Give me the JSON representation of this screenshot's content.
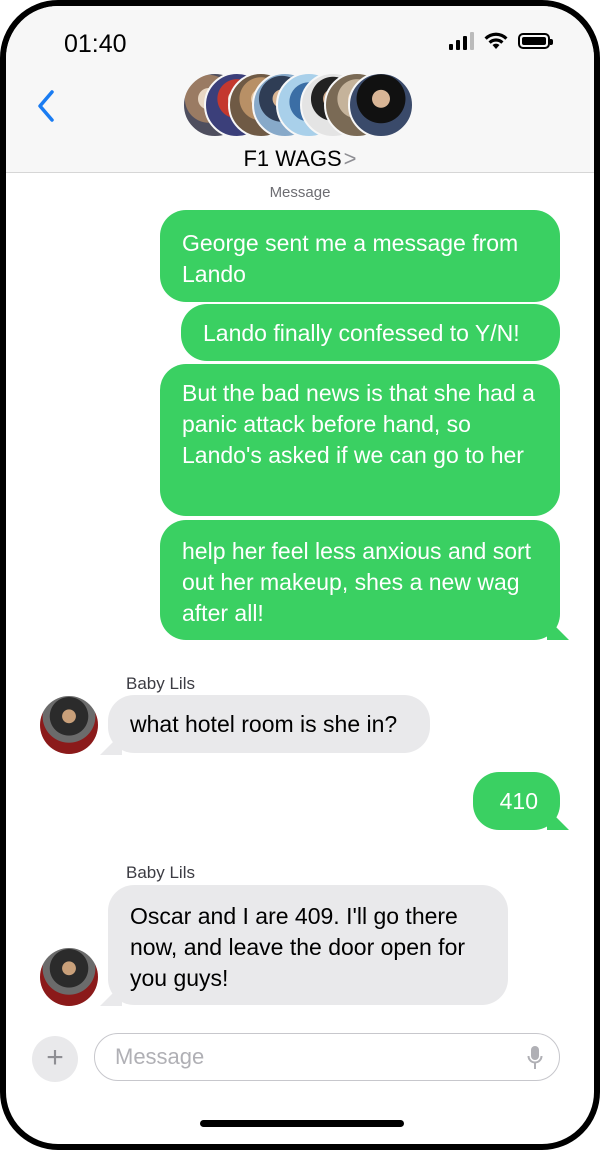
{
  "status_bar": {
    "time": "01:40",
    "icons": [
      "cellular-signal-icon",
      "wifi-icon",
      "battery-icon"
    ]
  },
  "header": {
    "back_icon": "chevron-left-icon",
    "group_name": "F1 WAGS",
    "group_chevron": ">",
    "member_avatar_count": 8
  },
  "thread": {
    "service_label": "Message",
    "messages": [
      {
        "direction": "outgoing",
        "text": "George sent me a message from Lando"
      },
      {
        "direction": "outgoing",
        "text": "Lando finally confessed to Y/N!"
      },
      {
        "direction": "outgoing",
        "text": "But the bad news is that she had a panic attack before hand, so Lando's asked if we can go to her"
      },
      {
        "direction": "outgoing",
        "text": "help her feel less anxious and sort out her makeup, shes a new wag after all!"
      },
      {
        "direction": "incoming",
        "sender": "Baby Lils",
        "text": "what hotel room is she in?"
      },
      {
        "direction": "outgoing",
        "text": "410"
      },
      {
        "direction": "incoming",
        "sender": "Baby Lils",
        "text": "Oscar and I are 409. I'll go there now, and leave the door open for you guys!"
      }
    ]
  },
  "composer": {
    "plus_label": "+",
    "placeholder": "Message",
    "value": "",
    "mic_icon": "microphone-icon"
  },
  "colors": {
    "outgoing_bubble": "#3ad062",
    "incoming_bubble": "#e9e9eb",
    "accent": "#1a7cf2"
  }
}
